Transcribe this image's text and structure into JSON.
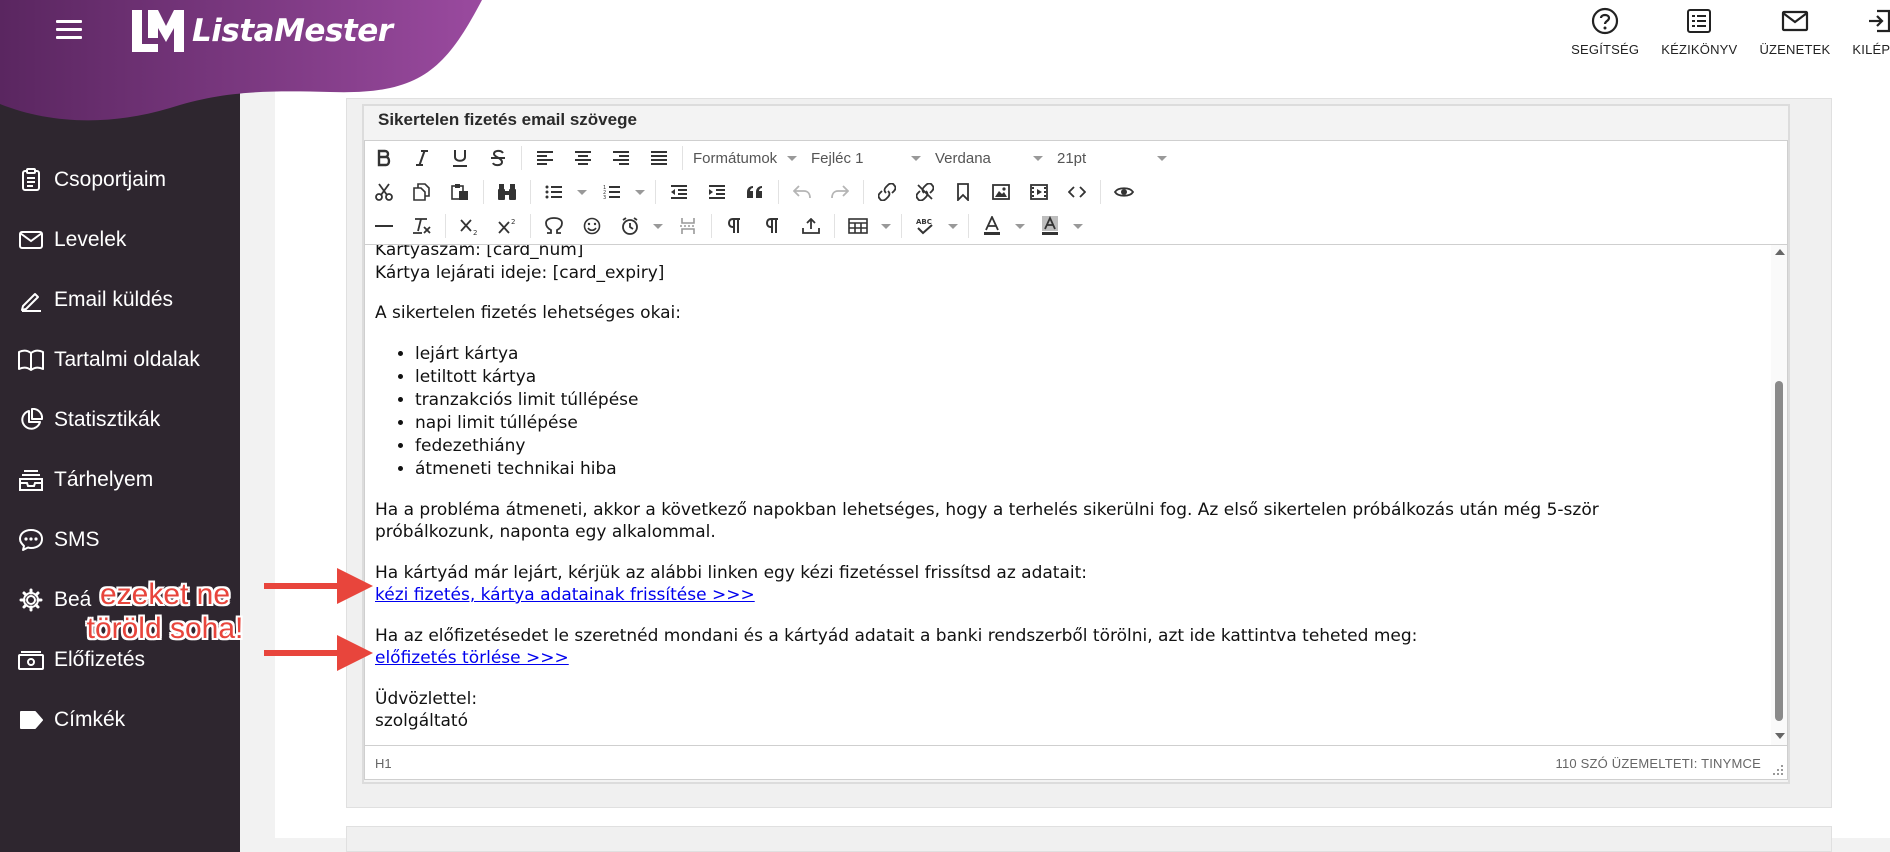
{
  "brand": {
    "name": "ListaMester",
    "primary_color": "#8c3f94",
    "sidebar_color": "#2e262f"
  },
  "sidebar": {
    "items": [
      {
        "label": "Csoportjaim",
        "icon": "clipboard-icon"
      },
      {
        "label": "Levelek",
        "icon": "envelope-icon"
      },
      {
        "label": "Email küldés",
        "icon": "pen-icon"
      },
      {
        "label": "Tartalmi oldalak",
        "icon": "book-icon"
      },
      {
        "label": "Statisztikák",
        "icon": "pie-chart-icon"
      },
      {
        "label": "Tárhelyem",
        "icon": "inbox-icon"
      },
      {
        "label": "SMS",
        "icon": "chat-icon"
      },
      {
        "label": "Beá",
        "icon": "gear-icon"
      },
      {
        "label": "Előfizetés",
        "icon": "cash-icon"
      },
      {
        "label": "Címkék",
        "icon": "tag-icon"
      }
    ]
  },
  "topbar": {
    "actions": [
      {
        "label": "SEGÍTSÉG",
        "icon": "help-icon"
      },
      {
        "label": "KÉZIKÖNYV",
        "icon": "manual-icon"
      },
      {
        "label": "ÜZENETEK",
        "icon": "mail-icon"
      },
      {
        "label": "KILÉPÉS",
        "icon": "logout-icon"
      }
    ]
  },
  "panel": {
    "title": "Sikertelen fizetés email szövege"
  },
  "editor": {
    "dropdowns": {
      "formats": "Formátumok",
      "heading": "Fejléc 1",
      "font": "Verdana",
      "size": "21pt"
    },
    "content": {
      "line1": "Kártyaszám: [card_num]",
      "line2": "Kártya lejárati ideje: [card_expiry]",
      "reasons_intro": "A sikertelen fizetés lehetséges okai:",
      "reasons": [
        "lejárt kártya",
        "letiltott kártya",
        "tranzakciós limit túllépése",
        "napi limit túllépése",
        "fedezethiány",
        "átmeneti technikai hiba"
      ],
      "temp_problem_1": "Ha a probléma átmeneti, akkor a következő napokban lehetséges, hogy a terhelés sikerülni fog. Az első sikertelen próbálkozás után még 5-ször",
      "temp_problem_2": "próbálkozunk, naponta egy alkalommal.",
      "expired_text": "Ha kártyád már lejárt, kérjük az alábbi linken egy kézi fizetéssel frissítsd az adatait:",
      "manual_pay_link": "kézi fizetés, kártya adatainak frissítése >>>",
      "cancel_text": "Ha az előfizetésedet le szeretnéd mondani és a kártyád adatait a banki rendszerből törölni, azt ide kattintva teheted meg:",
      "cancel_link": "előfizetés törlése >>>",
      "greeting": "Üdvözlettel:",
      "signature": "szolgáltató"
    },
    "status": {
      "path": "H1",
      "wordcount": "110 SZÓ ÜZEMELTETI: TINYMCE"
    }
  },
  "annotation": {
    "line1": "ezeket ne",
    "line2": "töröld soha!",
    "color": "#e8453c"
  }
}
